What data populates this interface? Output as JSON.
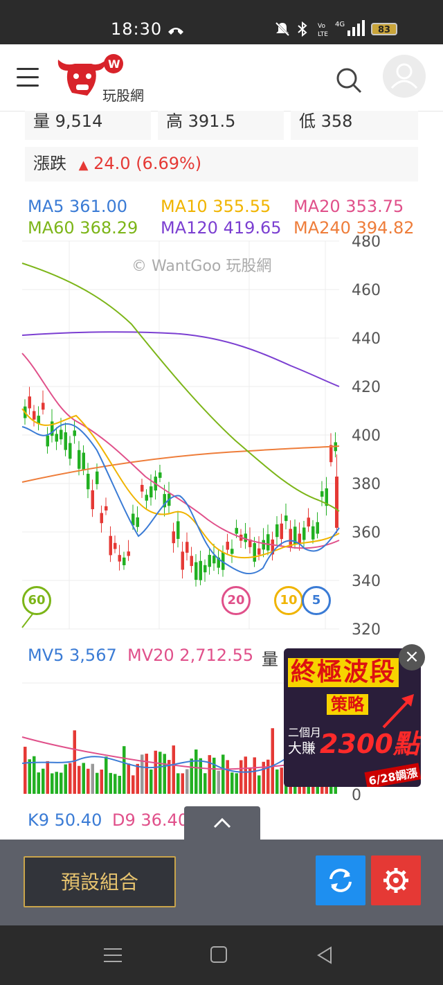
{
  "status_bar": {
    "time": "18:30",
    "battery": "83"
  },
  "header": {
    "logo_text": "玩股網"
  },
  "quote": {
    "volume_label": "量",
    "volume": "9,514",
    "high_label": "高",
    "high": "391.5",
    "low_label": "低",
    "low": "358",
    "change_label": "漲跌",
    "change_arrow": "▲",
    "change": "24.0 (6.69%)"
  },
  "ma_legend": {
    "ma5": "MA5 361.00",
    "ma10": "MA10 355.55",
    "ma20": "MA20 353.75",
    "ma60": "MA60 368.29",
    "ma120": "MA120 419.65",
    "ma240": "MA240 394.82"
  },
  "colors": {
    "ma5": "#3a7bd5",
    "ma10": "#f0b400",
    "ma20": "#e0508a",
    "ma60": "#7cb518",
    "ma120": "#7b3fd1",
    "ma240": "#ee7d3a",
    "up": "#e53935",
    "down": "#22b022"
  },
  "watermark": "© WantGoo 玩股網",
  "chart_data": {
    "type": "line",
    "ylim": [
      320,
      480
    ],
    "y_ticks": [
      "480",
      "460",
      "440",
      "420",
      "400",
      "380",
      "360",
      "340",
      "320"
    ],
    "markers": [
      "60",
      "20",
      "10",
      "5"
    ]
  },
  "volume_panel": {
    "mv5": "MV5 3,567",
    "mv20": "MV20 2,712.55",
    "label": "量",
    "zero": "0"
  },
  "kd": {
    "k9": "K9 50.40",
    "d9": "D9 36.40"
  },
  "ad": {
    "title": "終極波段",
    "subtitle": "策略",
    "months": "二個月",
    "gain": "大賺",
    "points": "2300點",
    "date": "6/28調漲",
    "close": "×"
  },
  "bottom": {
    "preset_label": "預設組合"
  }
}
